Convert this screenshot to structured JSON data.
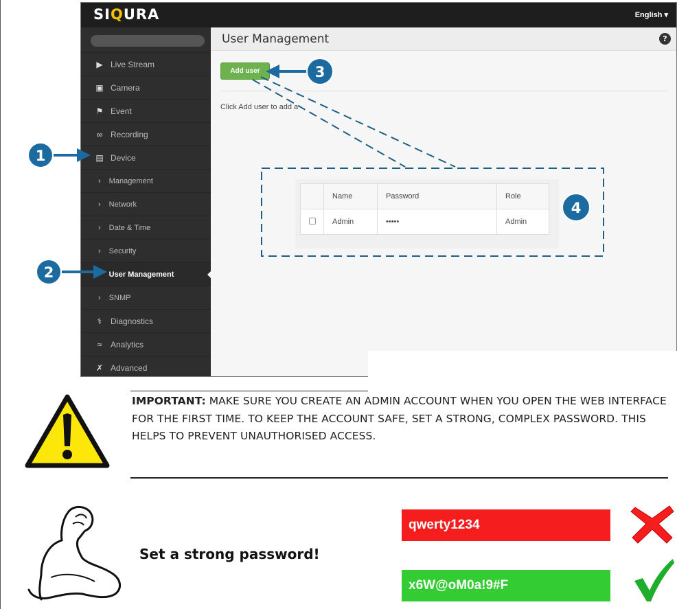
{
  "app": {
    "brand": {
      "pre": "SI",
      "accent": "Q",
      "post": "URA"
    },
    "language_label": "English ▾",
    "page_title": "User Management",
    "help_label": "?",
    "add_user_label": "Add user",
    "hint_text": "Click Add user to add a",
    "sidebar": {
      "items": [
        {
          "label": "Live Stream",
          "icon": "play-icon"
        },
        {
          "label": "Camera",
          "icon": "video-camera-icon"
        },
        {
          "label": "Event",
          "icon": "event-icon"
        },
        {
          "label": "Recording",
          "icon": "recording-icon"
        },
        {
          "label": "Device",
          "icon": "device-icon"
        },
        {
          "label": "Management",
          "icon": "chevron-right-icon"
        },
        {
          "label": "Network",
          "icon": "chevron-right-icon"
        },
        {
          "label": "Date & Time",
          "icon": "chevron-right-icon"
        },
        {
          "label": "Security",
          "icon": "chevron-right-icon"
        },
        {
          "label": "User Management",
          "icon": "chevron-right-icon"
        },
        {
          "label": "SNMP",
          "icon": "chevron-right-icon"
        },
        {
          "label": "Diagnostics",
          "icon": "stethoscope-icon"
        },
        {
          "label": "Analytics",
          "icon": "analytics-icon"
        },
        {
          "label": "Advanced",
          "icon": "tools-icon"
        }
      ]
    },
    "users_table": {
      "headers": [
        "Name",
        "Password",
        "Role"
      ],
      "rows": [
        {
          "name": "Admin",
          "password": "•••••",
          "role": "Admin"
        }
      ]
    }
  },
  "callouts": [
    "1",
    "2",
    "3",
    "4"
  ],
  "warning": {
    "label": "IMPORTANT:",
    "text": " MAKE SURE YOU CREATE AN ADMIN ACCOUNT WHEN YOU OPEN THE WEB INTERFACE FOR THE FIRST TIME. TO KEEP THE ACCOUNT SAFE, SET A STRONG, COMPLEX PASSWORD. THIS HELPS TO PREVENT UNAUTHORISED ACCESS."
  },
  "password_tip": {
    "title": "Set a strong password!",
    "bad_example": "qwerty1234",
    "good_example": "x6W@oM0a!9#F"
  },
  "colors": {
    "accent_yellow": "#f2c200",
    "callout_blue": "#1b6aa0",
    "add_user_green": "#6db24e",
    "bad_red": "#f51d1d",
    "good_green": "#33cc33"
  }
}
